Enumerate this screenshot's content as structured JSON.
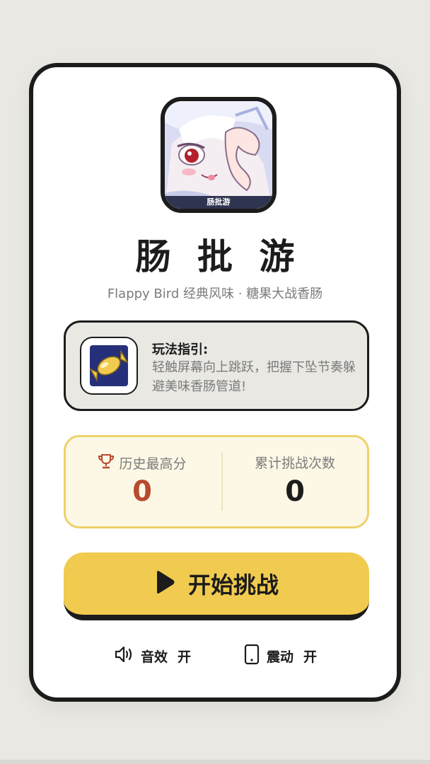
{
  "game": {
    "avatar_caption": "肠批游",
    "title": "肠 批 游",
    "subtitle": "Flappy Bird 经典风味 · 糖果大战香肠"
  },
  "guide": {
    "icon": "candy-icon",
    "heading": "玩法指引:",
    "text": "轻触屏幕向上跳跃，把握下坠节奏躲避美味香肠管道!"
  },
  "stats": {
    "best_label": "历史最高分",
    "best_icon": "trophy-icon",
    "best_value": "0",
    "attempts_label": "累计挑战次数",
    "attempts_value": "0"
  },
  "start_button": {
    "label": "开始挑战",
    "icon": "play-icon"
  },
  "settings": {
    "sound_label": "音效",
    "sound_state": "开",
    "sound_icon": "speaker-icon",
    "vibration_label": "震动",
    "vibration_state": "开",
    "vibration_icon": "phone-icon"
  },
  "colors": {
    "accent_yellow": "#f0cb4f",
    "score_red": "#b94a2e",
    "dark": "#1c1c1c",
    "background": "#e9e8e3"
  }
}
